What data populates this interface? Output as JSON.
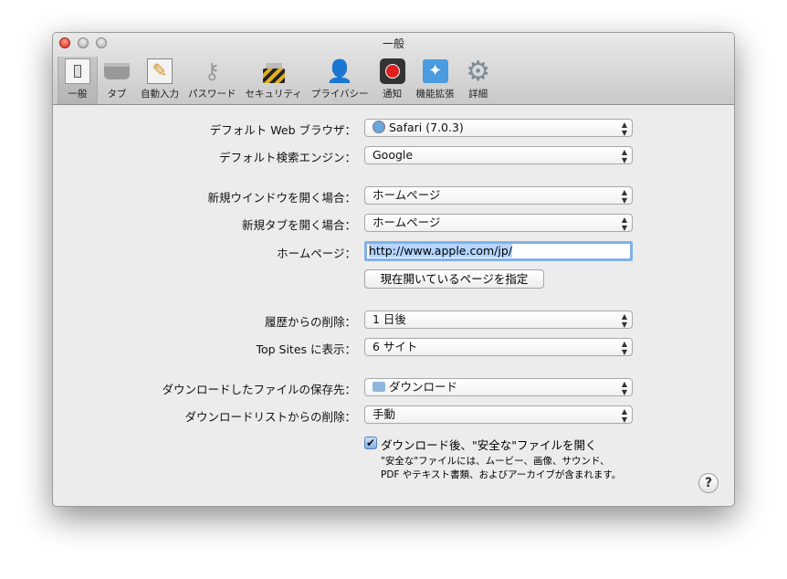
{
  "window": {
    "title": "一般"
  },
  "toolbar": [
    {
      "label": "一般",
      "icon": "switch-icon"
    },
    {
      "label": "タブ",
      "icon": "tabs-icon"
    },
    {
      "label": "自動入力",
      "icon": "autofill-icon"
    },
    {
      "label": "パスワード",
      "icon": "key-icon"
    },
    {
      "label": "セキュリティ",
      "icon": "lock-icon"
    },
    {
      "label": "プライバシー",
      "icon": "person-icon"
    },
    {
      "label": "通知",
      "icon": "notification-icon"
    },
    {
      "label": "機能拡張",
      "icon": "extensions-icon"
    },
    {
      "label": "詳細",
      "icon": "gear-icon"
    }
  ],
  "form": {
    "default_browser": {
      "label": "デフォルト Web ブラウザ：",
      "value": "Safari (7.0.3)"
    },
    "search_engine": {
      "label": "デフォルト検索エンジン：",
      "value": "Google"
    },
    "new_window": {
      "label": "新規ウインドウを開く場合：",
      "value": "ホームページ"
    },
    "new_tab": {
      "label": "新規タブを開く場合：",
      "value": "ホームページ"
    },
    "homepage": {
      "label": "ホームページ：",
      "value": "http://www.apple.com/jp/"
    },
    "set_current": "現在開いているページを指定",
    "history": {
      "label": "履歴からの削除：",
      "value": "1 日後"
    },
    "top_sites": {
      "label": "Top Sites に表示：",
      "value": "6 サイト"
    },
    "download_loc": {
      "label": "ダウンロードしたファイルの保存先：",
      "value": "ダウンロード"
    },
    "download_list": {
      "label": "ダウンロードリストからの削除：",
      "value": "手動"
    },
    "open_safe": {
      "label": "ダウンロード後、\"安全な\"ファイルを開く",
      "checked": true,
      "note1": "\"安全な\"ファイルには、ムービー、画像、サウンド、",
      "note2": "PDF やテキスト書類、およびアーカイブが含まれます。"
    }
  },
  "help": "?"
}
